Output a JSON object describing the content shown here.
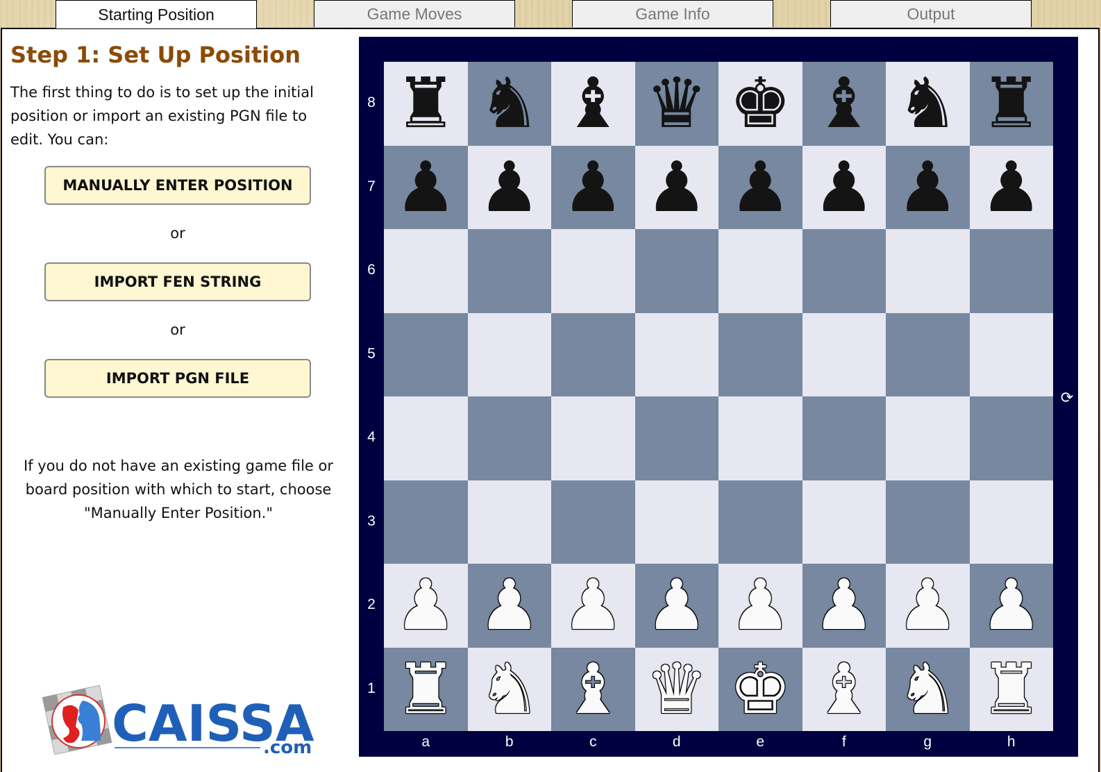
{
  "tabs": [
    {
      "label": "Starting Position",
      "active": true
    },
    {
      "label": "Game Moves",
      "active": false
    },
    {
      "label": "Game Info",
      "active": false
    },
    {
      "label": "Output",
      "active": false
    }
  ],
  "left_panel": {
    "title": "Step 1: Set Up Position",
    "intro": "The first thing to do is to set up the initial position or import an existing PGN file to edit. You can:",
    "buttons": [
      {
        "label": "MANUALLY ENTER POSITION"
      },
      {
        "label": "IMPORT FEN STRING"
      },
      {
        "label": "IMPORT PGN FILE"
      }
    ],
    "or_label": "or",
    "note": "If you do not have an existing game file or board position with which to start, choose \"Manually Enter Position.\""
  },
  "logo": {
    "brand": "CAISSA",
    "suffix": ".com",
    "brand_color": "#1f5fb8",
    "accent_color": "#d92020"
  },
  "board": {
    "colors": {
      "light": "#e6e7f1",
      "dark": "#7788a0",
      "frame": "#000040"
    },
    "ranks": [
      "8",
      "7",
      "6",
      "5",
      "4",
      "3",
      "2",
      "1"
    ],
    "files": [
      "a",
      "b",
      "c",
      "d",
      "e",
      "f",
      "g",
      "h"
    ],
    "position": [
      [
        "r",
        "n",
        "b",
        "q",
        "k",
        "b",
        "n",
        "r"
      ],
      [
        "p",
        "p",
        "p",
        "p",
        "p",
        "p",
        "p",
        "p"
      ],
      [
        "",
        "",
        "",
        "",
        "",
        "",
        "",
        ""
      ],
      [
        "",
        "",
        "",
        "",
        "",
        "",
        "",
        ""
      ],
      [
        "",
        "",
        "",
        "",
        "",
        "",
        "",
        ""
      ],
      [
        "",
        "",
        "",
        "",
        "",
        "",
        "",
        ""
      ],
      [
        "P",
        "P",
        "P",
        "P",
        "P",
        "P",
        "P",
        "P"
      ],
      [
        "R",
        "N",
        "B",
        "Q",
        "K",
        "B",
        "N",
        "R"
      ]
    ],
    "flip_icon": "refresh-icon",
    "flip_glyph": "⟳"
  }
}
